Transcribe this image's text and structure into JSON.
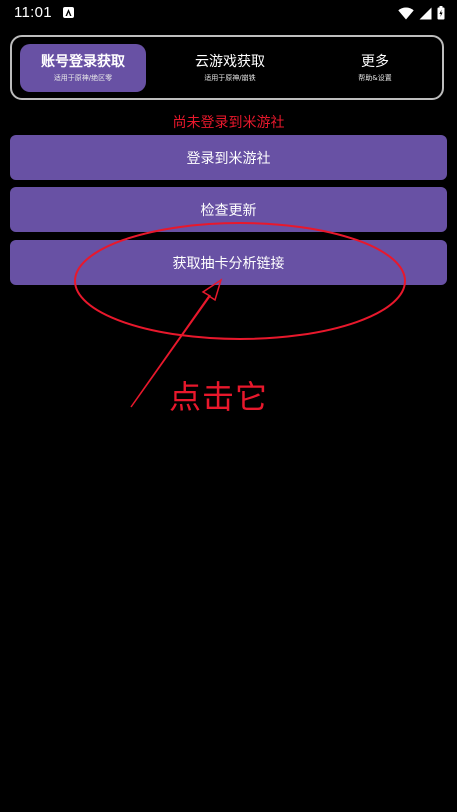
{
  "status_bar": {
    "time": "11:01"
  },
  "tabs": [
    {
      "label": "账号登录获取",
      "sub": "适用于原神/绝区零"
    },
    {
      "label": "云游戏获取",
      "sub": "适用于原神/崩铁"
    },
    {
      "label": "更多",
      "sub": "帮助&设置"
    }
  ],
  "login_status": "尚未登录到米游社",
  "buttons": {
    "login": "登录到米游社",
    "check_update": "检查更新",
    "get_gacha_link": "获取抽卡分析链接"
  },
  "annotation": {
    "text": "点击它"
  },
  "colors": {
    "accent": "#6851a4",
    "warning": "#e8182c",
    "background": "#000000"
  }
}
